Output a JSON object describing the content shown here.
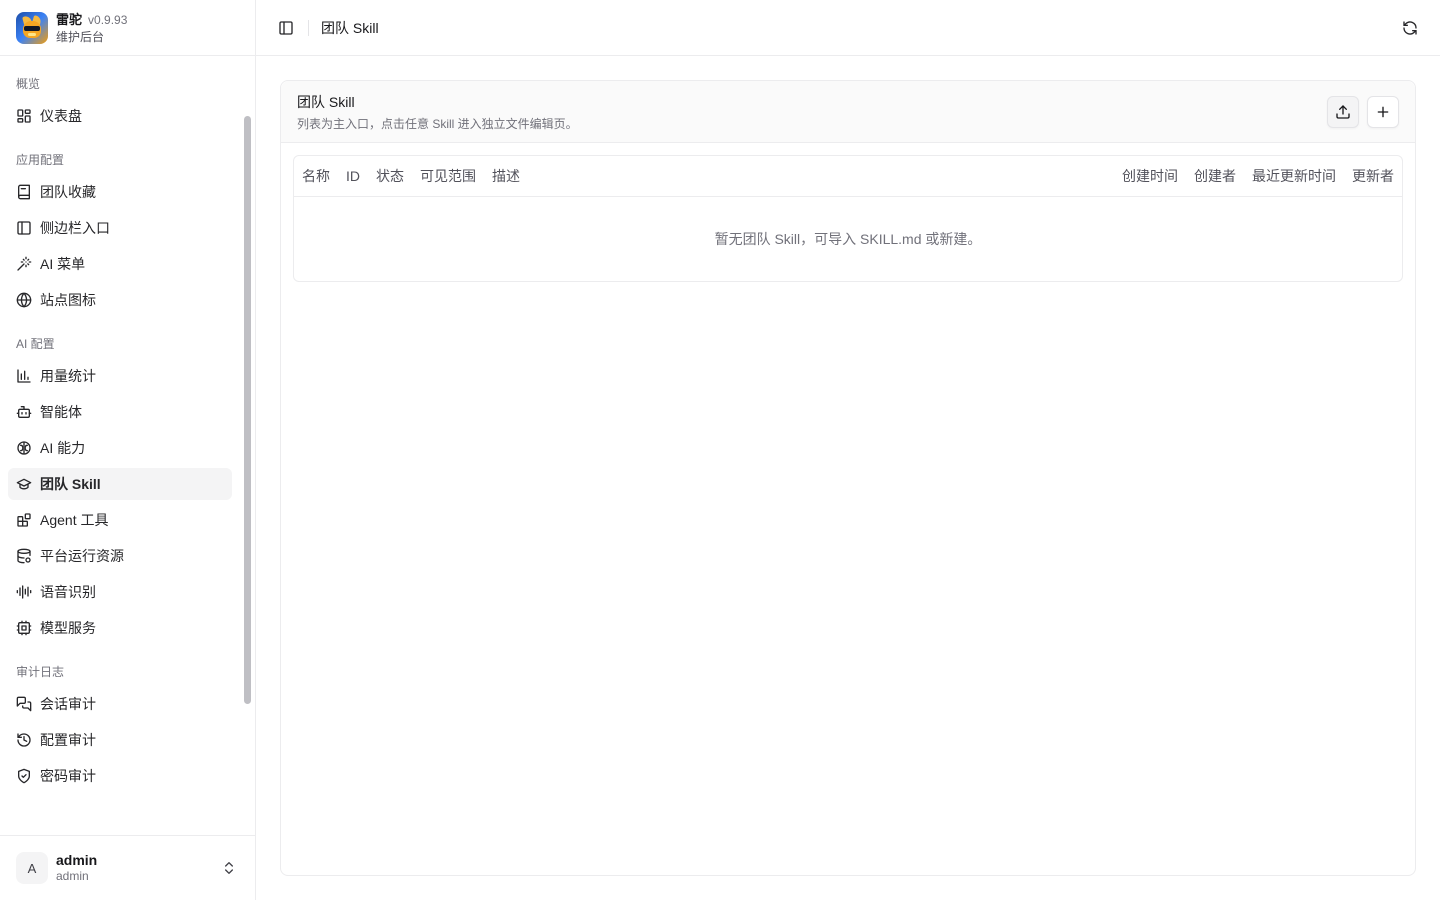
{
  "brand": {
    "name": "雷驼",
    "version": "v0.9.93",
    "subtitle": "维护后台"
  },
  "sidebar": {
    "groups": [
      {
        "label": "概览",
        "items": [
          {
            "label": "仪表盘",
            "icon": "dashboard-icon"
          }
        ]
      },
      {
        "label": "应用配置",
        "items": [
          {
            "label": "团队收藏",
            "icon": "book-icon"
          },
          {
            "label": "侧边栏入口",
            "icon": "panel-left-icon"
          },
          {
            "label": "AI 菜单",
            "icon": "wand-icon"
          },
          {
            "label": "站点图标",
            "icon": "globe-icon"
          }
        ]
      },
      {
        "label": "AI 配置",
        "items": [
          {
            "label": "用量统计",
            "icon": "bar-chart-icon"
          },
          {
            "label": "智能体",
            "icon": "bot-icon"
          },
          {
            "label": "AI 能力",
            "icon": "brain-icon"
          },
          {
            "label": "团队 Skill",
            "icon": "graduation-cap-icon",
            "active": true
          },
          {
            "label": "Agent 工具",
            "icon": "blocks-icon"
          },
          {
            "label": "平台运行资源",
            "icon": "database-icon"
          },
          {
            "label": "语音识别",
            "icon": "audio-lines-icon"
          },
          {
            "label": "模型服务",
            "icon": "cpu-icon"
          }
        ]
      },
      {
        "label": "审计日志",
        "items": [
          {
            "label": "会话审计",
            "icon": "messages-icon"
          },
          {
            "label": "配置审计",
            "icon": "history-icon"
          },
          {
            "label": "密码审计",
            "icon": "shield-check-icon"
          }
        ]
      }
    ]
  },
  "user": {
    "initial": "A",
    "name": "admin",
    "role": "admin"
  },
  "topbar": {
    "title": "团队 Skill"
  },
  "card": {
    "title": "团队 Skill",
    "description": "列表为主入口，点击任意 Skill 进入独立文件编辑页。",
    "import_icon": "upload-icon",
    "add_icon": "plus-icon"
  },
  "table": {
    "columns_left": [
      "名称",
      "ID",
      "状态",
      "可见范围",
      "描述"
    ],
    "columns_right": [
      "创建时间",
      "创建者",
      "最近更新时间",
      "更新者"
    ],
    "empty_text": "暂无团队 Skill，可导入 SKILL.md 或新建。"
  }
}
